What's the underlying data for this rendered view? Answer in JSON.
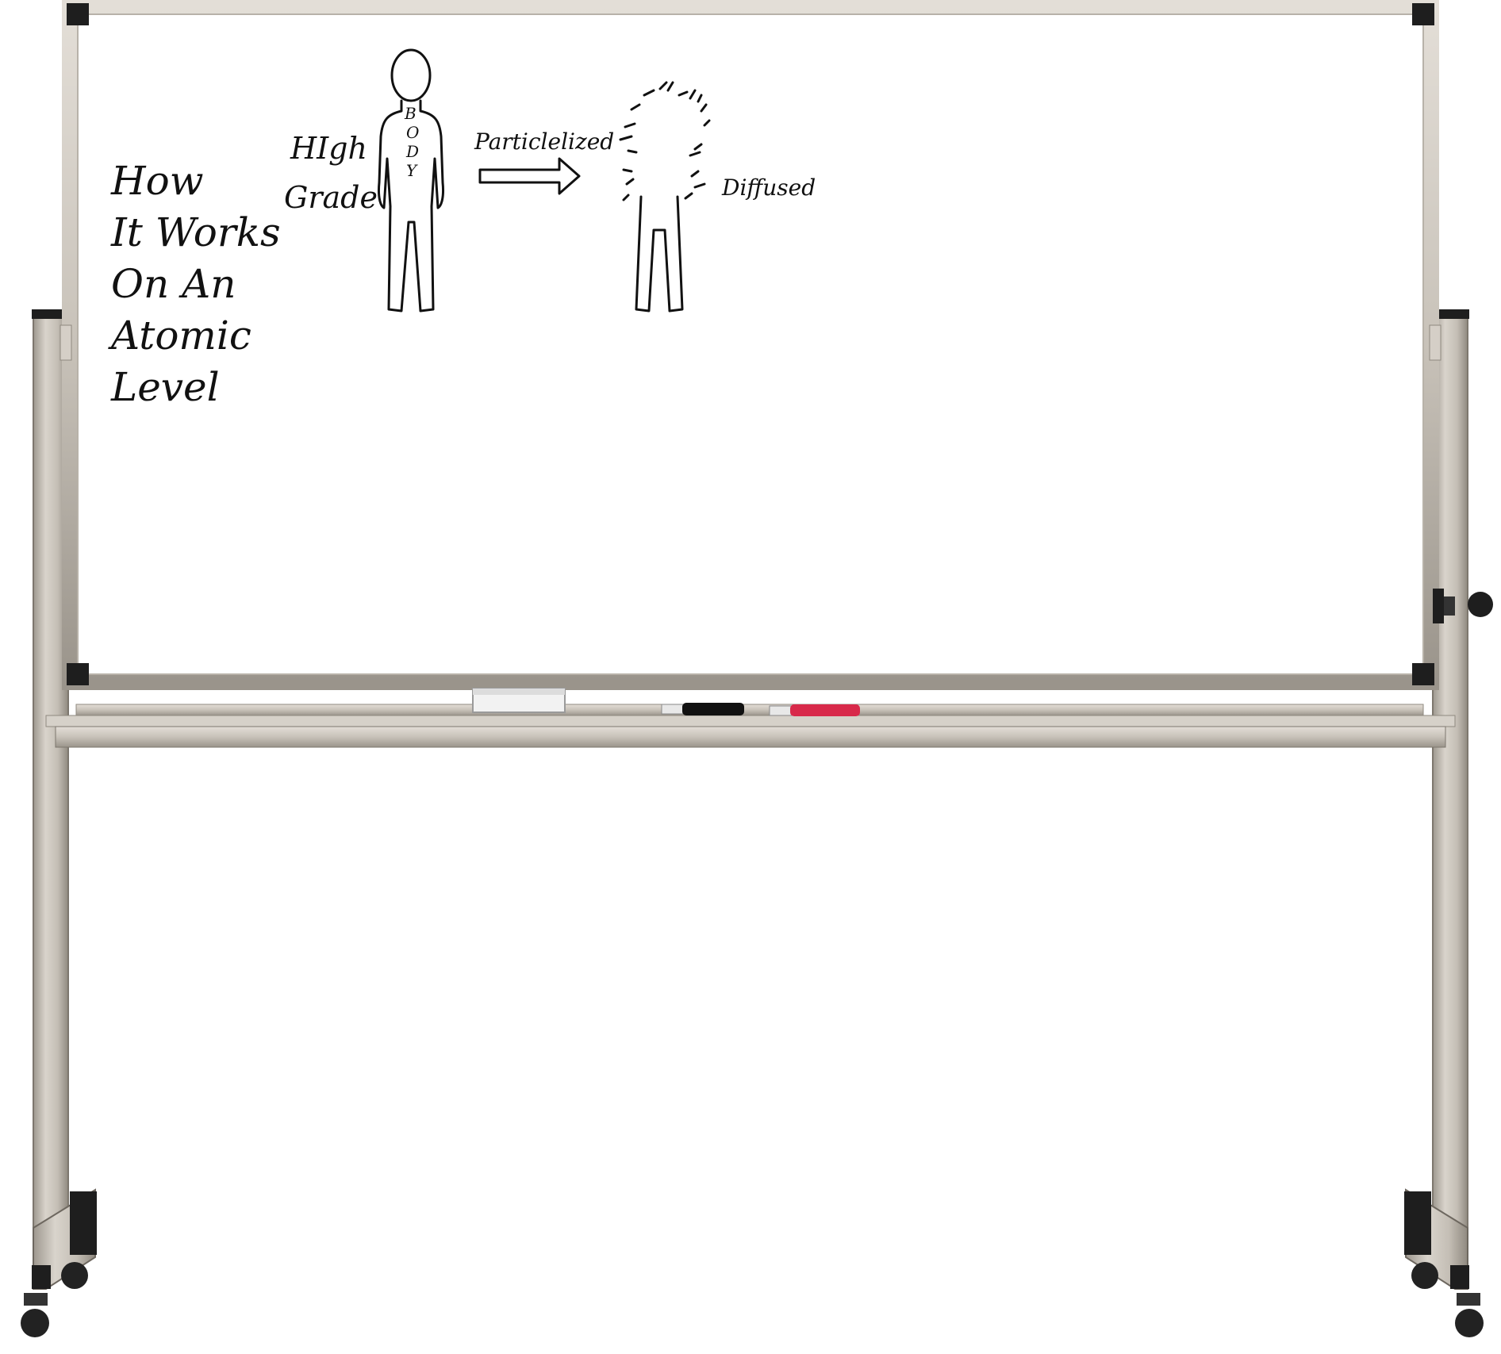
{
  "board": {
    "title_lines": [
      "How",
      "It Works",
      "On An",
      "Atomic",
      "Level"
    ],
    "label_high": "HIgh",
    "label_grade": "Grade",
    "body_letters": [
      "B",
      "O",
      "D",
      "Y"
    ],
    "label_particlelized": "Particlelized",
    "label_diffused": "Diffused"
  },
  "colors": {
    "frame": "#cfc9c0",
    "stand": "#c9c3ba",
    "marker_black": "#111111",
    "marker_red": "#d8294a",
    "caps": "#1e1e1e"
  }
}
